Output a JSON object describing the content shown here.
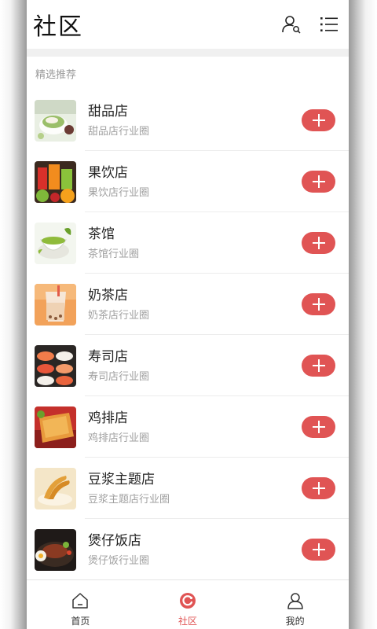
{
  "header": {
    "title": "社区"
  },
  "section_label": "精选推荐",
  "items": [
    {
      "name": "甜品店",
      "sub": "甜品店行业圈",
      "thumb": "dessert-image"
    },
    {
      "name": "果饮店",
      "sub": "果饮店行业圈",
      "thumb": "fruit-drink-image"
    },
    {
      "name": "茶馆",
      "sub": "茶馆行业圈",
      "thumb": "tea-image"
    },
    {
      "name": "奶茶店",
      "sub": "奶茶店行业圈",
      "thumb": "milk-tea-image"
    },
    {
      "name": "寿司店",
      "sub": "寿司店行业圈",
      "thumb": "sushi-image"
    },
    {
      "name": "鸡排店",
      "sub": "鸡排店行业圈",
      "thumb": "chicken-cutlet-image"
    },
    {
      "name": "豆浆主题店",
      "sub": "豆浆主题店行业圈",
      "thumb": "soymilk-image"
    },
    {
      "name": "煲仔饭店",
      "sub": "煲仔饭行业圈",
      "thumb": "claypot-rice-image"
    }
  ],
  "tabs": [
    {
      "label": "首页",
      "icon": "home-icon"
    },
    {
      "label": "社区",
      "icon": "community-icon",
      "active": true
    },
    {
      "label": "我的",
      "icon": "profile-icon"
    }
  ],
  "colors": {
    "accent": "#e05454",
    "subtext": "#a0a0a0",
    "divider": "#ececec"
  }
}
